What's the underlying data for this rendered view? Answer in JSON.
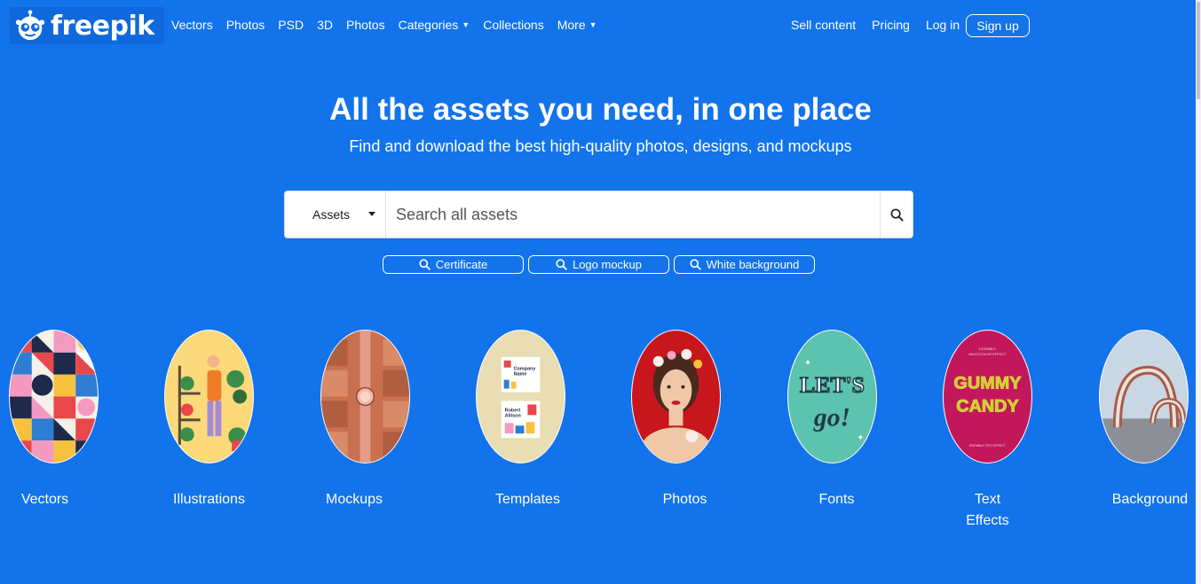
{
  "brand": {
    "name": "freepik"
  },
  "nav": {
    "left": [
      {
        "label": "Vectors"
      },
      {
        "label": "Photos"
      },
      {
        "label": "PSD"
      },
      {
        "label": "3D"
      },
      {
        "label": "Photos"
      },
      {
        "label": "Categories",
        "dropdown": true
      },
      {
        "label": "Collections"
      },
      {
        "label": "More",
        "dropdown": true
      }
    ],
    "right": [
      {
        "label": "Sell content"
      },
      {
        "label": "Pricing"
      },
      {
        "label": "Log in"
      }
    ],
    "signup": "Sign up"
  },
  "hero": {
    "title": "All the assets you need, in one place",
    "subtitle": "Find and download the best high-quality photos, designs, and mockups"
  },
  "search": {
    "category": "Assets",
    "placeholder": "Search all assets",
    "icon": "search-icon"
  },
  "suggestions": [
    {
      "label": "Certificate"
    },
    {
      "label": "Logo mockup"
    },
    {
      "label": "White background"
    }
  ],
  "categories": [
    {
      "line1": "Vectors",
      "line2": ""
    },
    {
      "line1": "Illustrations",
      "line2": ""
    },
    {
      "line1": "Mockups",
      "line2": ""
    },
    {
      "line1": "Templates",
      "line2": ""
    },
    {
      "line1": "Photos",
      "line2": ""
    },
    {
      "line1": "Fonts",
      "line2": ""
    },
    {
      "line1": "Text",
      "line2": "Effects"
    },
    {
      "line1": "Background",
      "line2": ""
    }
  ],
  "thumbnail_text": {
    "templates": {
      "line1": "Company",
      "line2": "Name",
      "line3": "Robert",
      "line4": "Allison"
    },
    "fonts": {
      "line1": "LET'S",
      "line2": "go!"
    },
    "text_effects": {
      "line1": "EDITABLE",
      "line2": "MULTICOLOR EFFECT",
      "line3": "GUMMY",
      "line4": "CANDY",
      "line5": "EDITABLE TEXT EFFECT"
    }
  },
  "colors": {
    "background": "#1273eb",
    "logo_bg": "#0f68dc"
  }
}
